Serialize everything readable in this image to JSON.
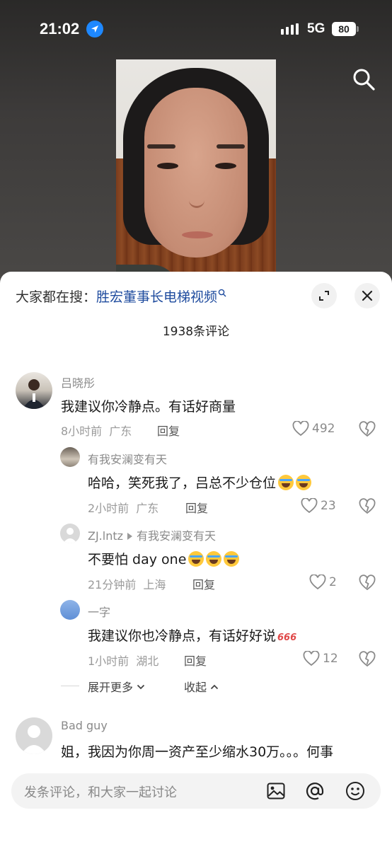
{
  "status_bar": {
    "time": "21:02",
    "network": "5G",
    "battery": "80",
    "icons": [
      "location-arrow-icon",
      "signal-icon"
    ]
  },
  "hot_search": {
    "prefix": "大家都在搜：",
    "keyword": "胜宏董事长电梯视频",
    "accent_color": "#1e4b9e"
  },
  "comment_count": "1938条评论",
  "comments": [
    {
      "user": "吕晓彤",
      "text": "我建议你冷静点。有话好商量",
      "time": "8小时前",
      "location": "广东",
      "reply_label": "回复",
      "likes": "492"
    },
    {
      "user": "有我安澜变有天",
      "text": "哈哈，笑死我了，吕总不少仓位",
      "time": "2小时前",
      "location": "广东",
      "reply_label": "回复",
      "likes": "23"
    },
    {
      "user": "ZJ.lntz",
      "reply_to": "有我安澜变有天",
      "text": "不要怕 day one",
      "time": "21分钟前",
      "location": "上海",
      "reply_label": "回复",
      "likes": "2"
    },
    {
      "user": "一字",
      "text": "我建议你也冷静点，有话好好说",
      "suffix": "666",
      "time": "1小时前",
      "location": "湖北",
      "reply_label": "回复",
      "likes": "12"
    },
    {
      "user": "Bad guy",
      "text": "姐，我因为你周一资产至少缩水30万。。。何事"
    }
  ],
  "replies_controls": {
    "expand_more": "展开更多",
    "collapse": "收起"
  },
  "input_bar": {
    "placeholder": "发条评论，和大家一起讨论",
    "icons": [
      "image-icon",
      "at-icon",
      "emoji-icon"
    ]
  }
}
